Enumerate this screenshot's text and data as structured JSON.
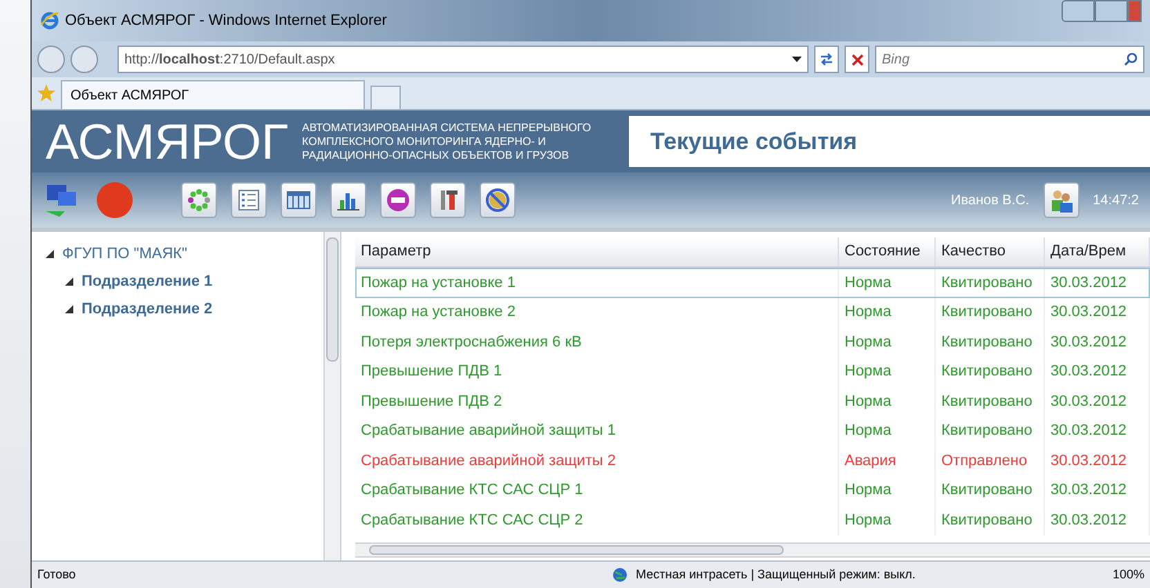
{
  "window": {
    "title": "Объект АСМЯРОГ - Windows Internet Explorer"
  },
  "address_bar": {
    "url": "http://**localhost**:2710/Default.aspx",
    "search_placeholder": "Bing"
  },
  "tabs": [
    {
      "label": "Объект АСМЯРОГ",
      "selected": true
    }
  ],
  "app_header": {
    "logo": "АСМЯРОГ",
    "subtitle": "АВТОМАТИЗИРОВАННАЯ СИСТЕМА НЕПРЕРЫВНОГО КОМПЛЕКСНОГО МОНИТОРИНГА ЯДЕРНО- И РАДИАЦИОННО-ОПАСНЫХ ОБЪЕКТОВ И ГРУЗОВ",
    "page_title": "Текущие события",
    "user": "Иванов В.С.",
    "time": "14:47:2"
  },
  "tree": [
    {
      "label": "ФГУП ПО \"МАЯК\"",
      "expanded": true,
      "children": [
        {
          "label": "Подразделение 1",
          "expanded": true
        },
        {
          "label": "Подразделение 2",
          "expanded": true
        }
      ]
    }
  ],
  "table": {
    "columns": [
      "Параметр",
      "Состояние",
      "Качество",
      "Дата/Врем"
    ],
    "rows": [
      {
        "cells": [
          "Пожар на установке 1",
          "Норма",
          "Квитировано",
          "30.03.2012"
        ],
        "alarm": false,
        "selected": true
      },
      {
        "cells": [
          "Пожар на установке 2",
          "Норма",
          "Квитировано",
          "30.03.2012"
        ],
        "alarm": false,
        "selected": false
      },
      {
        "cells": [
          "Потеря электроснабжения 6 кВ",
          "Норма",
          "Квитировано",
          "30.03.2012"
        ],
        "alarm": false,
        "selected": false
      },
      {
        "cells": [
          "Превышение ПДВ 1",
          "Норма",
          "Квитировано",
          "30.03.2012"
        ],
        "alarm": false,
        "selected": false
      },
      {
        "cells": [
          "Превышение ПДВ 2",
          "Норма",
          "Квитировано",
          "30.03.2012"
        ],
        "alarm": false,
        "selected": false
      },
      {
        "cells": [
          "Срабатывание аварийной защиты 1",
          "Норма",
          "Квитировано",
          "30.03.2012"
        ],
        "alarm": false,
        "selected": false
      },
      {
        "cells": [
          "Срабатывание аварийной защиты 2",
          "Авария",
          "Отправлено",
          "30.03.2012"
        ],
        "alarm": true,
        "selected": false
      },
      {
        "cells": [
          "Срабатывание КТС САС СЦР 1",
          "Норма",
          "Квитировано",
          "30.03.2012"
        ],
        "alarm": false,
        "selected": false
      },
      {
        "cells": [
          "Срабатывание КТС САС СЦР 2",
          "Норма",
          "Квитировано",
          "30.03.2012"
        ],
        "alarm": false,
        "selected": false
      }
    ]
  },
  "status_bar": {
    "text": "Готово",
    "zone": "Местная интрасеть | Защищенный режим: выкл.",
    "zoom": "100%"
  }
}
